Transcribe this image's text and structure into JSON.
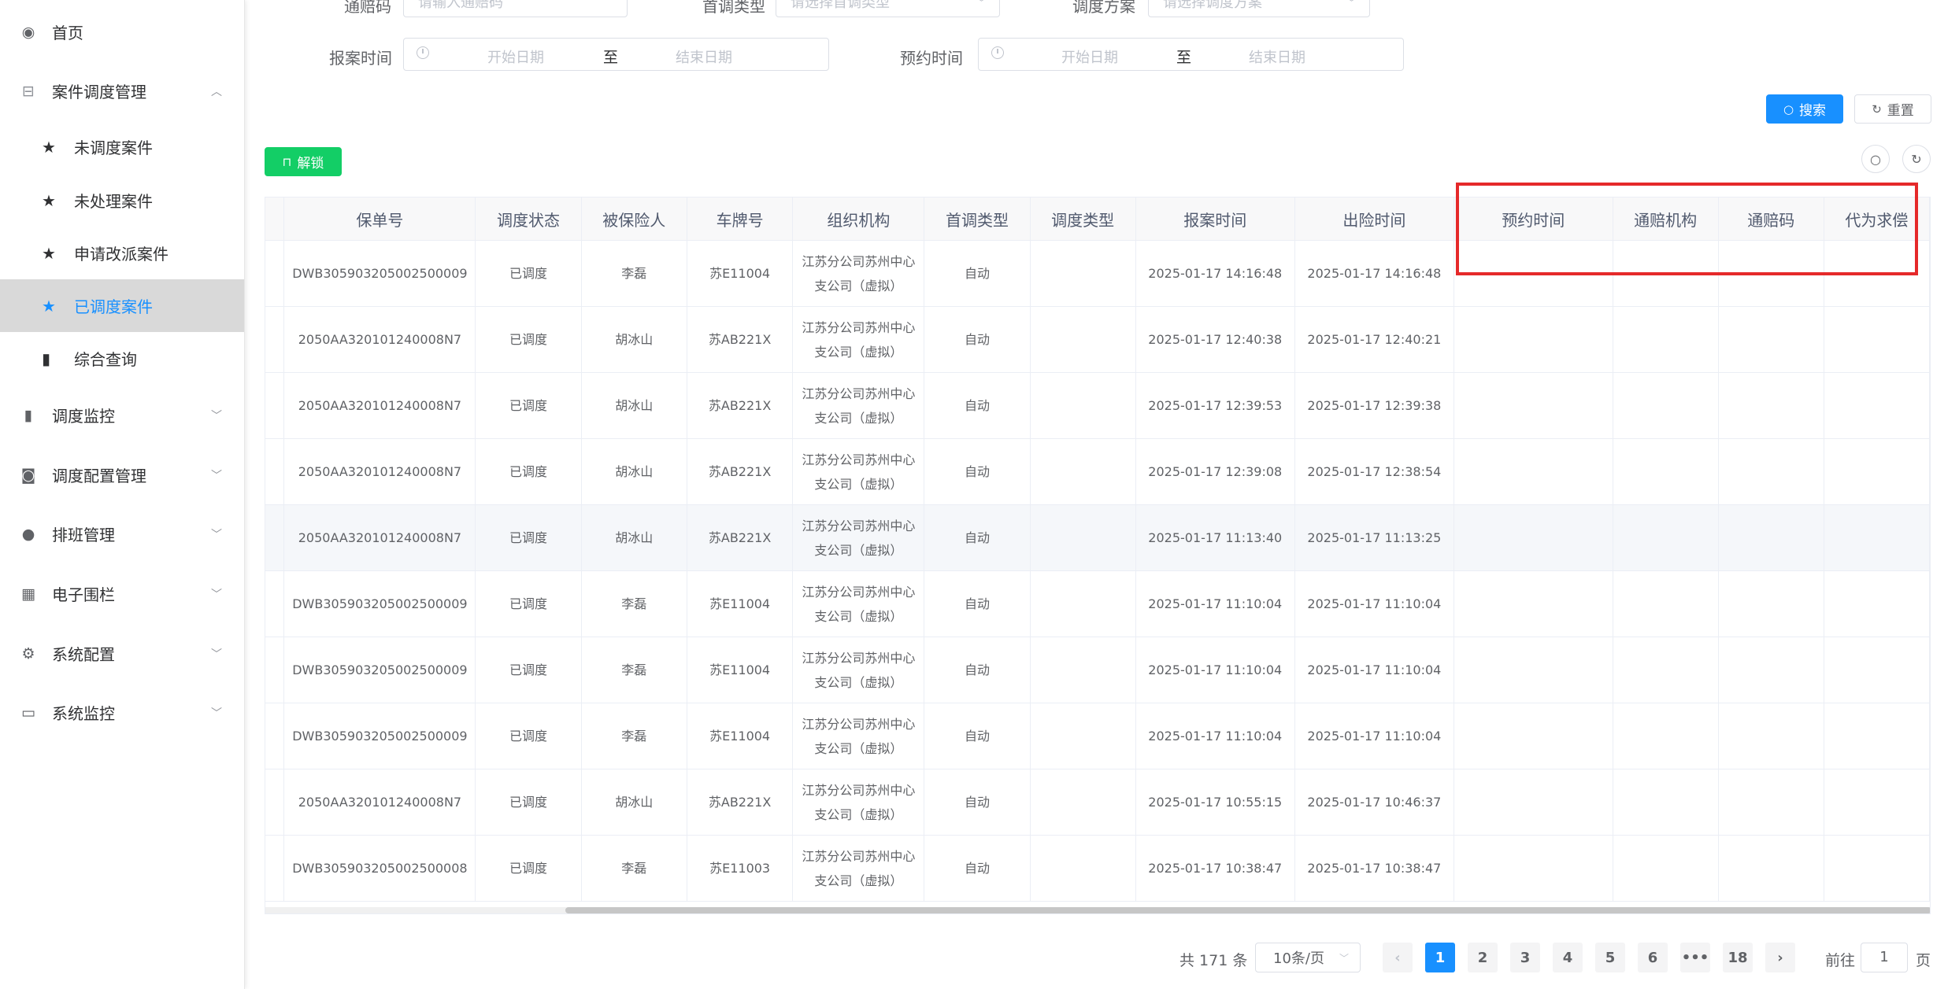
{
  "sidebar": {
    "home": "首页",
    "dispatch_group": "案件调度管理",
    "sub_items": [
      "未调度案件",
      "未处理案件",
      "申请改派案件",
      "已调度案件",
      "综合查询"
    ],
    "monitor": "调度监控",
    "config": "调度配置管理",
    "schedule": "排班管理",
    "fence": "电子围栏",
    "sysconfig": "系统配置",
    "sysmonitor": "系统监控"
  },
  "filters": {
    "row1": {
      "label1": "通赔码",
      "placeholder1": "请输入通赔码",
      "label2": "首调类型",
      "placeholder2": "请选择首调类型",
      "label3": "调度方案",
      "placeholder3": "请选择调度方案"
    },
    "report_label": "报案时间",
    "appoint_label": "预约时间",
    "start_ph": "开始日期",
    "end_ph": "结束日期",
    "to": "至"
  },
  "buttons": {
    "search": "搜索",
    "reset": "重置",
    "unlock": "解锁"
  },
  "table": {
    "headers": [
      "保单号",
      "调度状态",
      "被保险人",
      "车牌号",
      "组织机构",
      "首调类型",
      "调度类型",
      "报案时间",
      "出险时间",
      "预约时间",
      "通赔机构",
      "通赔码",
      "代为求偿"
    ],
    "rows": [
      {
        "policy": "DWB305903205002500009",
        "status": "已调度",
        "insured": "李磊",
        "plate": "苏E11004",
        "org": "江苏分公司苏州中心支公司（虚拟）",
        "first": "自动",
        "dtype": "",
        "report": "2025-01-17 14:16:48",
        "accident": "2025-01-17 14:16:48"
      },
      {
        "policy": "2050AA320101240008N7",
        "status": "已调度",
        "insured": "胡冰山",
        "plate": "苏AB221X",
        "org": "江苏分公司苏州中心支公司（虚拟）",
        "first": "自动",
        "dtype": "",
        "report": "2025-01-17 12:40:38",
        "accident": "2025-01-17 12:40:21"
      },
      {
        "policy": "2050AA320101240008N7",
        "status": "已调度",
        "insured": "胡冰山",
        "plate": "苏AB221X",
        "org": "江苏分公司苏州中心支公司（虚拟）",
        "first": "自动",
        "dtype": "",
        "report": "2025-01-17 12:39:53",
        "accident": "2025-01-17 12:39:38"
      },
      {
        "policy": "2050AA320101240008N7",
        "status": "已调度",
        "insured": "胡冰山",
        "plate": "苏AB221X",
        "org": "江苏分公司苏州中心支公司（虚拟）",
        "first": "自动",
        "dtype": "",
        "report": "2025-01-17 12:39:08",
        "accident": "2025-01-17 12:38:54"
      },
      {
        "policy": "2050AA320101240008N7",
        "status": "已调度",
        "insured": "胡冰山",
        "plate": "苏AB221X",
        "org": "江苏分公司苏州中心支公司（虚拟）",
        "first": "自动",
        "dtype": "",
        "report": "2025-01-17 11:13:40",
        "accident": "2025-01-17 11:13:25"
      },
      {
        "policy": "DWB305903205002500009",
        "status": "已调度",
        "insured": "李磊",
        "plate": "苏E11004",
        "org": "江苏分公司苏州中心支公司（虚拟）",
        "first": "自动",
        "dtype": "",
        "report": "2025-01-17 11:10:04",
        "accident": "2025-01-17 11:10:04"
      },
      {
        "policy": "DWB305903205002500009",
        "status": "已调度",
        "insured": "李磊",
        "plate": "苏E11004",
        "org": "江苏分公司苏州中心支公司（虚拟）",
        "first": "自动",
        "dtype": "",
        "report": "2025-01-17 11:10:04",
        "accident": "2025-01-17 11:10:04"
      },
      {
        "policy": "DWB305903205002500009",
        "status": "已调度",
        "insured": "李磊",
        "plate": "苏E11004",
        "org": "江苏分公司苏州中心支公司（虚拟）",
        "first": "自动",
        "dtype": "",
        "report": "2025-01-17 11:10:04",
        "accident": "2025-01-17 11:10:04"
      },
      {
        "policy": "2050AA320101240008N7",
        "status": "已调度",
        "insured": "胡冰山",
        "plate": "苏AB221X",
        "org": "江苏分公司苏州中心支公司（虚拟）",
        "first": "自动",
        "dtype": "",
        "report": "2025-01-17 10:55:15",
        "accident": "2025-01-17 10:46:37"
      },
      {
        "policy": "DWB305903205002500008",
        "status": "已调度",
        "insured": "李磊",
        "plate": "苏E11003",
        "org": "江苏分公司苏州中心支公司（虚拟）",
        "first": "自动",
        "dtype": "",
        "report": "2025-01-17 10:38:47",
        "accident": "2025-01-17 10:38:47"
      }
    ]
  },
  "pagination": {
    "total": "共 171 条",
    "page_size": "10条/页",
    "pages": [
      "1",
      "2",
      "3",
      "4",
      "5",
      "6",
      "•••",
      "18"
    ],
    "prev": "‹",
    "next": "›",
    "goto_prefix": "前往",
    "goto_value": "1",
    "goto_suffix": "页"
  },
  "colors": {
    "primary": "#1890ff",
    "success": "#13ce66",
    "highlight_box": "#e5292a"
  }
}
